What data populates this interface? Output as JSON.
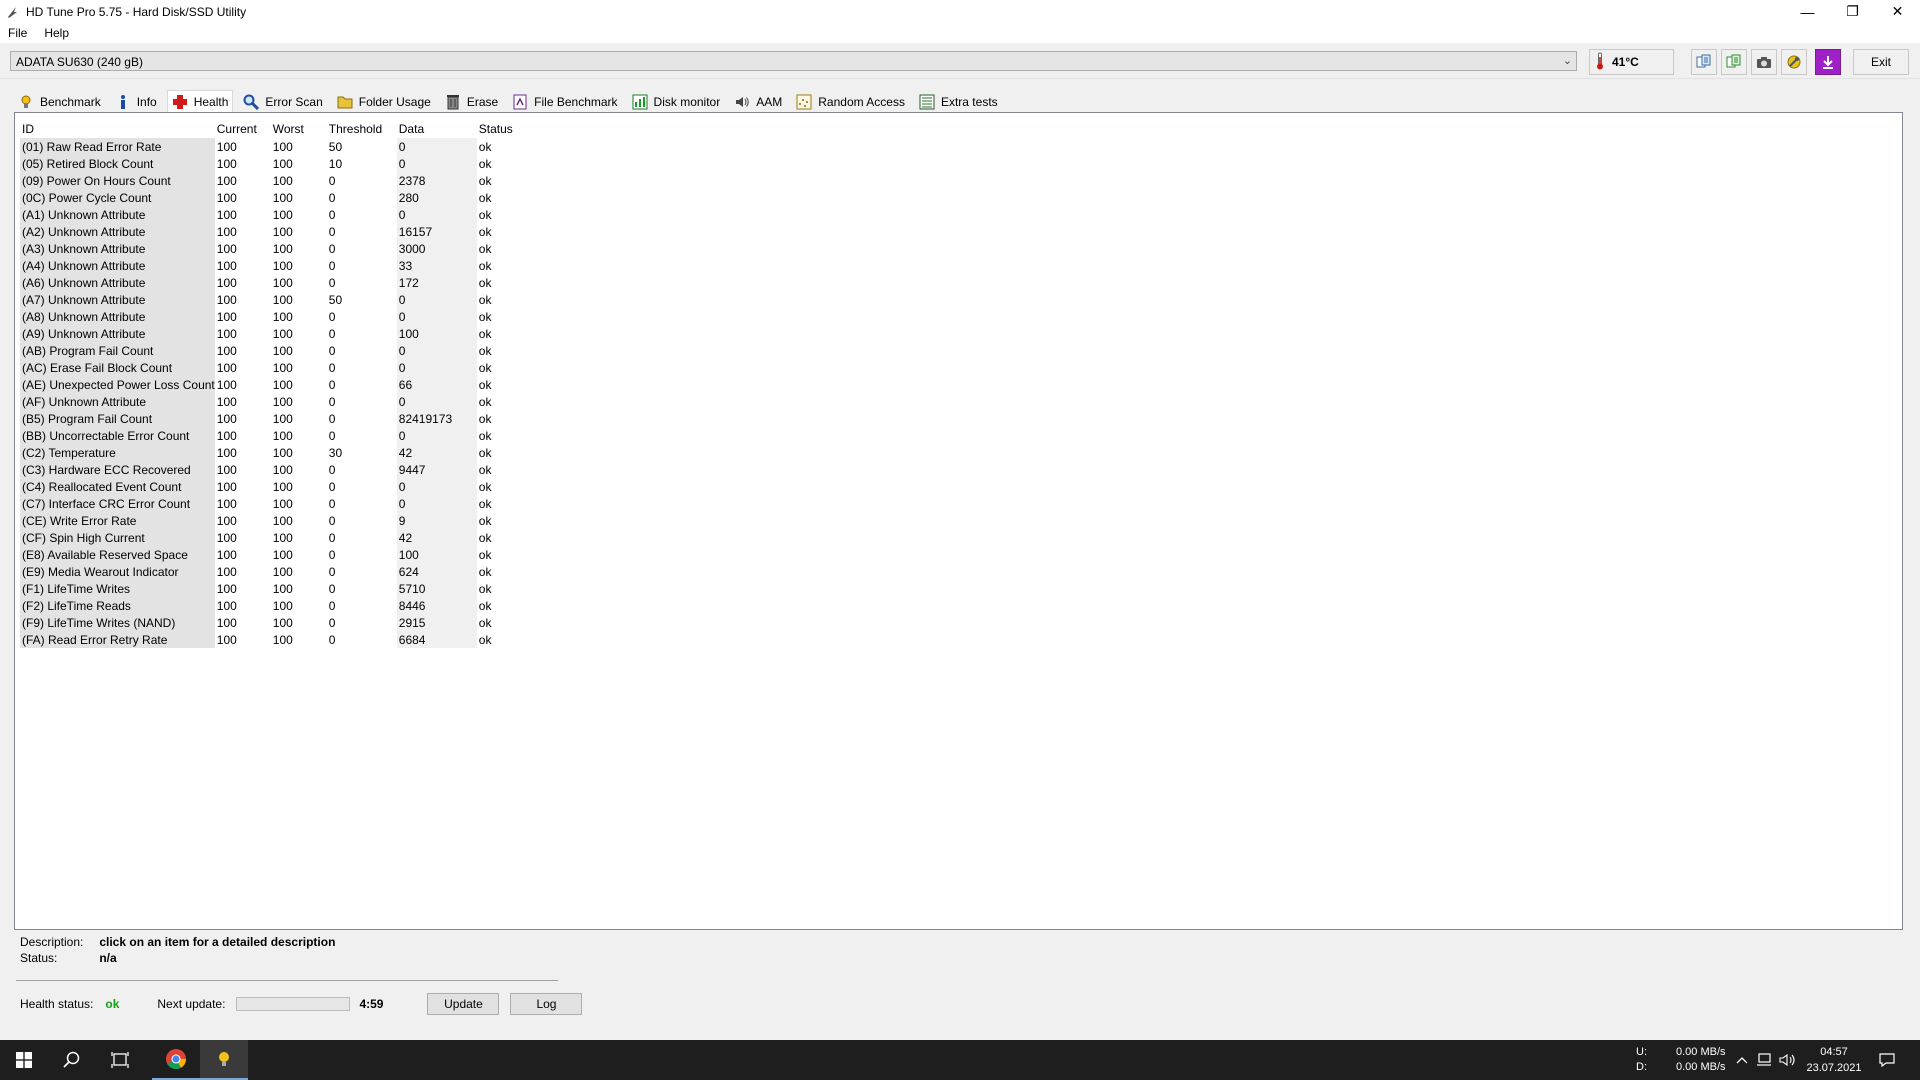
{
  "window": {
    "title": "HD Tune Pro 5.75 - Hard Disk/SSD Utility",
    "icon": "hdtune-app-icon"
  },
  "menu": {
    "items": [
      "File",
      "Help"
    ]
  },
  "drive": {
    "selected": "ADATA SU630 (240 gB)",
    "temperature": "41°C"
  },
  "toolbar": {
    "buttons": [
      "copy-info-icon",
      "copy-all-icon",
      "screenshot-camera-icon",
      "options-wrench-icon",
      "save-download-icon"
    ],
    "exit_label": "Exit"
  },
  "tabs": [
    {
      "label": "Benchmark",
      "icon": "benchmark-icon"
    },
    {
      "label": "Info",
      "icon": "info-icon"
    },
    {
      "label": "Health",
      "icon": "health-cross-icon",
      "active": true
    },
    {
      "label": "Error Scan",
      "icon": "magnifier-icon"
    },
    {
      "label": "Folder Usage",
      "icon": "folder-icon"
    },
    {
      "label": "Erase",
      "icon": "trash-icon"
    },
    {
      "label": "File Benchmark",
      "icon": "file-benchmark-icon"
    },
    {
      "label": "Disk monitor",
      "icon": "disk-monitor-icon"
    },
    {
      "label": "AAM",
      "icon": "speaker-icon"
    },
    {
      "label": "Random Access",
      "icon": "random-access-icon"
    },
    {
      "label": "Extra tests",
      "icon": "extra-tests-icon"
    }
  ],
  "table": {
    "headers": [
      "ID",
      "Current",
      "Worst",
      "Threshold",
      "Data",
      "Status"
    ],
    "rows": [
      [
        "(01) Raw Read Error Rate",
        "100",
        "100",
        "50",
        "0",
        "ok"
      ],
      [
        "(05) Retired Block Count",
        "100",
        "100",
        "10",
        "0",
        "ok"
      ],
      [
        "(09) Power On Hours Count",
        "100",
        "100",
        "0",
        "2378",
        "ok"
      ],
      [
        "(0C) Power Cycle Count",
        "100",
        "100",
        "0",
        "280",
        "ok"
      ],
      [
        "(A1) Unknown Attribute",
        "100",
        "100",
        "0",
        "0",
        "ok"
      ],
      [
        "(A2) Unknown Attribute",
        "100",
        "100",
        "0",
        "16157",
        "ok"
      ],
      [
        "(A3) Unknown Attribute",
        "100",
        "100",
        "0",
        "3000",
        "ok"
      ],
      [
        "(A4) Unknown Attribute",
        "100",
        "100",
        "0",
        "33",
        "ok"
      ],
      [
        "(A6) Unknown Attribute",
        "100",
        "100",
        "0",
        "172",
        "ok"
      ],
      [
        "(A7) Unknown Attribute",
        "100",
        "100",
        "50",
        "0",
        "ok"
      ],
      [
        "(A8) Unknown Attribute",
        "100",
        "100",
        "0",
        "0",
        "ok"
      ],
      [
        "(A9) Unknown Attribute",
        "100",
        "100",
        "0",
        "100",
        "ok"
      ],
      [
        "(AB) Program Fail Count",
        "100",
        "100",
        "0",
        "0",
        "ok"
      ],
      [
        "(AC) Erase Fail Block Count",
        "100",
        "100",
        "0",
        "0",
        "ok"
      ],
      [
        "(AE) Unexpected Power Loss Count",
        "100",
        "100",
        "0",
        "66",
        "ok"
      ],
      [
        "(AF) Unknown Attribute",
        "100",
        "100",
        "0",
        "0",
        "ok"
      ],
      [
        "(B5) Program Fail Count",
        "100",
        "100",
        "0",
        "82419173",
        "ok"
      ],
      [
        "(BB) Uncorrectable Error Count",
        "100",
        "100",
        "0",
        "0",
        "ok"
      ],
      [
        "(C2) Temperature",
        "100",
        "100",
        "30",
        "42",
        "ok"
      ],
      [
        "(C3) Hardware ECC Recovered",
        "100",
        "100",
        "0",
        "9447",
        "ok"
      ],
      [
        "(C4) Reallocated Event Count",
        "100",
        "100",
        "0",
        "0",
        "ok"
      ],
      [
        "(C7) Interface CRC Error Count",
        "100",
        "100",
        "0",
        "0",
        "ok"
      ],
      [
        "(CE) Write Error Rate",
        "100",
        "100",
        "0",
        "9",
        "ok"
      ],
      [
        "(CF) Spin High Current",
        "100",
        "100",
        "0",
        "42",
        "ok"
      ],
      [
        "(E8) Available Reserved Space",
        "100",
        "100",
        "0",
        "100",
        "ok"
      ],
      [
        "(E9) Media Wearout Indicator",
        "100",
        "100",
        "0",
        "624",
        "ok"
      ],
      [
        "(F1) LifeTime Writes",
        "100",
        "100",
        "0",
        "5710",
        "ok"
      ],
      [
        "(F2) LifeTime Reads",
        "100",
        "100",
        "0",
        "8446",
        "ok"
      ],
      [
        "(F9) LifeTime Writes (NAND)",
        "100",
        "100",
        "0",
        "2915",
        "ok"
      ],
      [
        "(FA) Read Error Retry Rate",
        "100",
        "100",
        "0",
        "6684",
        "ok"
      ]
    ]
  },
  "details": {
    "description_label": "Description:",
    "description_value": "click on an item for a detailed description",
    "status_label": "Status:",
    "status_value": "n/a"
  },
  "health": {
    "status_label": "Health status:",
    "status_value": "ok",
    "next_update_label": "Next update:",
    "countdown": "4:59",
    "update_label": "Update",
    "log_label": "Log",
    "status_color": "#16a016"
  },
  "taskbar": {
    "apps": [
      "windows-start-icon",
      "search-icon",
      "task-view-icon",
      "chrome-icon",
      "hdtune-taskbar-icon"
    ],
    "net_u_label": "U:",
    "net_d_label": "D:",
    "net_u": "0.00 MB/s",
    "net_d": "0.00 MB/s",
    "time": "04:57",
    "date": "23.07.2021"
  }
}
